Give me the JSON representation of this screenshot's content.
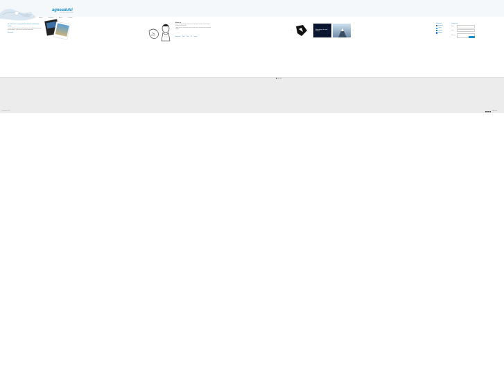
{
  "header": {
    "logo": "agneadutri",
    "tagline": "web design · graphic design"
  },
  "nav": {
    "items": [
      {
        "label": "Home"
      },
      {
        "label": "Portfolio"
      },
      {
        "label": "About"
      },
      {
        "label": "Contact"
      }
    ]
  },
  "intro": {
    "title": "Hi, welcome to my portfolio website and design studio",
    "text": "I create websites, graphics and illustrations for small businesses and creative people. Take a look at my latest work below.",
    "link": "Read more »"
  },
  "about": {
    "heading": "About me",
    "paragraph1": "I am a freelance designer with years of experience in web and print design, branding and illustration.",
    "paragraph2": "I enjoy working closely with clients to create clean, functional and memorable designs.",
    "links": [
      "Read more",
      "Skills",
      "Tools",
      "CV",
      "Contact"
    ]
  },
  "portfolio": {
    "prev": "‹",
    "next": "›",
    "items": [
      {
        "caption": ""
      },
      {
        "caption": "New design for your website"
      },
      {
        "caption": ""
      }
    ]
  },
  "social": {
    "heading": "Follow me",
    "items": [
      {
        "label": "Facebook"
      },
      {
        "label": "Twitter"
      },
      {
        "label": "LinkedIn"
      },
      {
        "label": "Behance"
      }
    ]
  },
  "contact": {
    "heading": "Contact me",
    "fields": [
      {
        "label": "Name"
      },
      {
        "label": "Email"
      },
      {
        "label": "Message"
      }
    ],
    "send_label": "Send"
  },
  "footer": {
    "copyright": "© agneadutri 2012",
    "right_text": "Back to top"
  },
  "colors": {
    "accent": "#1a8ec4",
    "band": "#ececec"
  }
}
